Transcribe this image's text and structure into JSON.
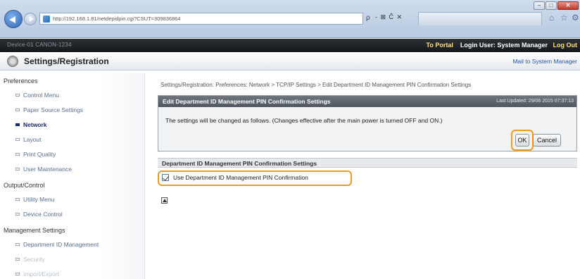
{
  "browser": {
    "url": "http://192.168.1.81/netdepidpin.cgi?CSUT=309836864",
    "window_min": "–",
    "window_max": "□",
    "window_close": "✕",
    "search_glyph": "ρ",
    "address_controls": "- ⊠ Ĉ ✕",
    "icons": [
      "back-icon",
      "forward-icon",
      "home-icon",
      "star-icon",
      "gear-icon"
    ],
    "home_glyph": "⌂",
    "star_glyph": "☆",
    "gear_glyph": "⚙"
  },
  "header": {
    "product_text": "Device-01   CANON-1234",
    "to_portal": "To Portal",
    "login_user": "Login User: System Manager",
    "logout": "Log Out"
  },
  "title": {
    "text": "Settings/Registration",
    "mail_link": "Mail to System Manager"
  },
  "sidebar": {
    "sections": [
      {
        "heading": "Preferences",
        "items": [
          {
            "label": "Control Menu",
            "state": "normal"
          },
          {
            "label": "Paper Source Settings",
            "state": "normal"
          },
          {
            "label": "Network",
            "state": "active"
          },
          {
            "label": "Layout",
            "state": "normal"
          },
          {
            "label": "Print Quality",
            "state": "normal"
          },
          {
            "label": "User Maintenance",
            "state": "normal"
          }
        ]
      },
      {
        "heading": "Output/Control",
        "items": [
          {
            "label": "Utility Menu",
            "state": "normal"
          },
          {
            "label": "Device Control",
            "state": "normal"
          }
        ]
      },
      {
        "heading": "Management Settings",
        "items": [
          {
            "label": "Department ID Management",
            "state": "normal"
          },
          {
            "label": "Security",
            "state": "faded"
          },
          {
            "label": "Import/Export",
            "state": "faded"
          }
        ]
      }
    ]
  },
  "main": {
    "breadcrumb": "Settings/Registration: Preferences: Network > TCP/IP Settings > Edit Department ID Management PIN Confirmation Settings",
    "edit_panel": {
      "title": "Edit Department ID Management PIN Confirmation Settings",
      "last_updated": "Last Updated: 29/06 2015 07:37:13",
      "message": "The settings will be changed as follows. (Changes effective after the main power is turned OFF and ON.)",
      "ok_label": "OK",
      "cancel_label": "Cancel"
    },
    "settings": {
      "title": "Department ID Management PIN Confirmation Settings",
      "checkbox_label": "Use Department ID Management PIN Confirmation",
      "checked": true
    },
    "highlight_color": "#f39a1a"
  }
}
